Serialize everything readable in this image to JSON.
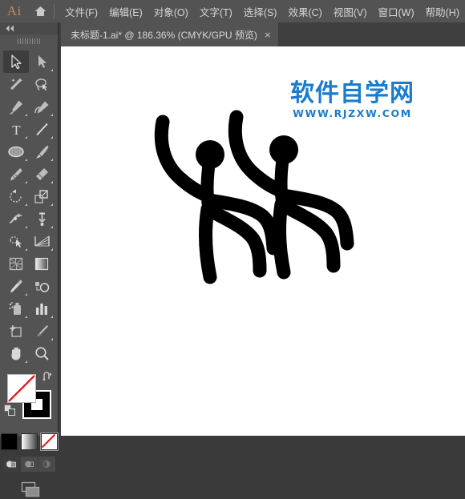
{
  "app": {
    "logo_text": "Ai",
    "home_icon": "home-icon"
  },
  "menubar": {
    "items": [
      {
        "label": "文件(F)",
        "name": "menu-file"
      },
      {
        "label": "编辑(E)",
        "name": "menu-edit"
      },
      {
        "label": "对象(O)",
        "name": "menu-object"
      },
      {
        "label": "文字(T)",
        "name": "menu-type"
      },
      {
        "label": "选择(S)",
        "name": "menu-select"
      },
      {
        "label": "效果(C)",
        "name": "menu-effect"
      },
      {
        "label": "视图(V)",
        "name": "menu-view"
      },
      {
        "label": "窗口(W)",
        "name": "menu-window"
      },
      {
        "label": "帮助(H)",
        "name": "menu-help"
      }
    ]
  },
  "tabbar": {
    "document_title": "未标题-1.ai* @ 186.36% (CMYK/GPU 预览)",
    "close_label": "×"
  },
  "toolbar": {
    "collapse_label": "«",
    "tools": [
      {
        "name": "selection-tool",
        "label": "选择工具",
        "active": true,
        "corner": false
      },
      {
        "name": "direct-selection-tool",
        "label": "直接选择工具",
        "active": false,
        "corner": true
      },
      {
        "name": "magic-wand-tool",
        "label": "魔棒工具",
        "active": false,
        "corner": false
      },
      {
        "name": "lasso-tool",
        "label": "套索工具",
        "active": false,
        "corner": false
      },
      {
        "name": "pen-tool",
        "label": "钢笔工具",
        "active": false,
        "corner": true
      },
      {
        "name": "curvature-tool",
        "label": "曲率工具",
        "active": false,
        "corner": true
      },
      {
        "name": "type-tool",
        "label": "文字工具",
        "active": false,
        "corner": true
      },
      {
        "name": "line-segment-tool",
        "label": "直线段工具",
        "active": false,
        "corner": true
      },
      {
        "name": "ellipse-tool",
        "label": "椭圆工具",
        "active": false,
        "corner": true
      },
      {
        "name": "paintbrush-tool",
        "label": "画笔工具",
        "active": false,
        "corner": true
      },
      {
        "name": "shaper-tool",
        "label": "Shaper 工具",
        "active": false,
        "corner": true
      },
      {
        "name": "eraser-tool",
        "label": "橡皮擦工具",
        "active": false,
        "corner": true
      },
      {
        "name": "rotate-tool",
        "label": "旋转工具",
        "active": false,
        "corner": true
      },
      {
        "name": "scale-tool",
        "label": "缩放工具",
        "active": false,
        "corner": true
      },
      {
        "name": "width-tool",
        "label": "宽度工具",
        "active": false,
        "corner": true
      },
      {
        "name": "free-transform-tool",
        "label": "自由变换工具",
        "active": false,
        "corner": true
      },
      {
        "name": "shape-builder-tool",
        "label": "形状生成器工具",
        "active": false,
        "corner": true
      },
      {
        "name": "perspective-grid-tool",
        "label": "透视网格工具",
        "active": false,
        "corner": true
      },
      {
        "name": "mesh-tool",
        "label": "网格工具",
        "active": false,
        "corner": false
      },
      {
        "name": "gradient-tool",
        "label": "渐变工具",
        "active": false,
        "corner": false
      },
      {
        "name": "eyedropper-tool",
        "label": "吸管工具",
        "active": false,
        "corner": true
      },
      {
        "name": "blend-tool",
        "label": "混合工具",
        "active": false,
        "corner": false
      },
      {
        "name": "symbol-sprayer-tool",
        "label": "符号喷枪工具",
        "active": false,
        "corner": true
      },
      {
        "name": "column-graph-tool",
        "label": "柱形图工具",
        "active": false,
        "corner": true
      },
      {
        "name": "artboard-tool",
        "label": "画板工具",
        "active": false,
        "corner": false
      },
      {
        "name": "slice-tool",
        "label": "切片工具",
        "active": false,
        "corner": true
      },
      {
        "name": "hand-tool",
        "label": "抓手工具",
        "active": false,
        "corner": true
      },
      {
        "name": "zoom-tool",
        "label": "缩放显示工具",
        "active": false,
        "corner": false
      }
    ],
    "fill": {
      "name": "fill-swatch",
      "color": "#ffffff",
      "is_none": true
    },
    "stroke": {
      "name": "stroke-swatch",
      "color": "#000000",
      "is_none": false
    },
    "swap_icon": "swap-fill-stroke-icon",
    "default_icon": "default-fill-stroke-icon",
    "color_modes": [
      {
        "name": "color-mode-solid",
        "color": "#000000",
        "selected": false
      },
      {
        "name": "color-mode-gradient",
        "color": "gradient",
        "selected": false
      },
      {
        "name": "color-mode-none",
        "color": "none",
        "selected": true
      }
    ],
    "draw_modes": [
      {
        "name": "draw-normal-mode",
        "active": true
      },
      {
        "name": "draw-behind-mode",
        "active": false
      },
      {
        "name": "draw-inside-mode",
        "active": false
      }
    ],
    "screen_mode": {
      "name": "screen-mode-button"
    }
  },
  "canvas": {
    "background": "#ffffff",
    "watermark": {
      "cn_text": "软件自学网",
      "url_text": "WWW.RJZXW.COM",
      "color": "#1a7ccd"
    },
    "artwork": {
      "name": "stick-figures-artwork",
      "description": "两个举手火柴人图形",
      "stroke_color": "#000000",
      "figure_count": 2
    }
  }
}
